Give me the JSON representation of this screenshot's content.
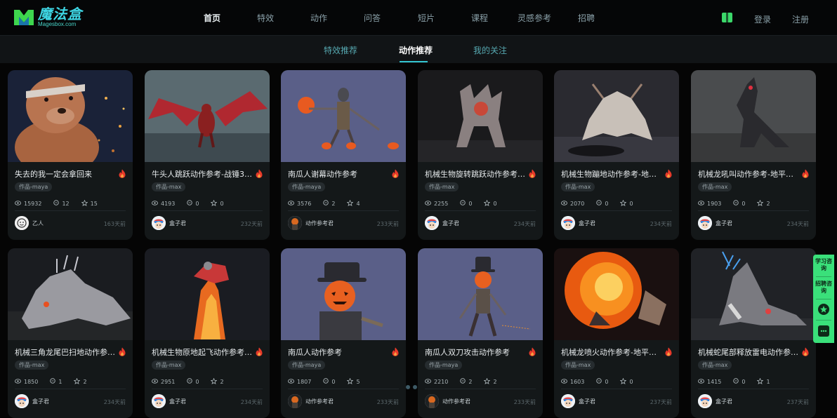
{
  "header": {
    "logo_cn": "魔法盒",
    "logo_en": "Magesbox.com",
    "nav": [
      "首页",
      "特效",
      "动作",
      "问答",
      "短片",
      "课程",
      "灵感参考",
      "招聘"
    ],
    "login": "登录",
    "register": "注册"
  },
  "subnav": {
    "tabs": [
      "特效推荐",
      "动作推荐",
      "我的关注"
    ]
  },
  "cards": [
    {
      "title": "失去的我一定会拿回来",
      "tag": "作品-maya",
      "views": "15932",
      "comments": "12",
      "stars": "15",
      "user": "乙人",
      "ago": "163天前",
      "thumb": "bear"
    },
    {
      "title": "牛头人跳跃动作参考-战锤3 Th...",
      "tag": "作品-max",
      "views": "4193",
      "comments": "0",
      "stars": "0",
      "user": "盒子君",
      "ago": "232天前",
      "thumb": "dragon"
    },
    {
      "title": "南瓜人谢幕动作参考",
      "tag": "作品-maya",
      "views": "3576",
      "comments": "2",
      "stars": "4",
      "user": "动作参考君",
      "ago": "233天前",
      "thumb": "pumpkin1"
    },
    {
      "title": "机械生物旋转跳跃动作参考-地...",
      "tag": "作品-max",
      "views": "2255",
      "comments": "0",
      "stars": "0",
      "user": "盒子君",
      "ago": "234天前",
      "thumb": "mech1"
    },
    {
      "title": "机械生物蹦地动作参考-地平线...",
      "tag": "作品-max",
      "views": "2070",
      "comments": "0",
      "stars": "0",
      "user": "盒子君",
      "ago": "234天前",
      "thumb": "mech2"
    },
    {
      "title": "机械龙吼叫动作参考-地平线西...",
      "tag": "作品-max",
      "views": "1903",
      "comments": "0",
      "stars": "2",
      "user": "盒子君",
      "ago": "234天前",
      "thumb": "mech3"
    },
    {
      "title": "机械三角龙尾巴扫地动作参考-...",
      "tag": "作品-max",
      "views": "1850",
      "comments": "1",
      "stars": "2",
      "user": "盒子君",
      "ago": "234天前",
      "thumb": "mech4"
    },
    {
      "title": "机械生物原地起飞动作参考-地...",
      "tag": "作品-max",
      "views": "2951",
      "comments": "0",
      "stars": "2",
      "user": "盒子君",
      "ago": "234天前",
      "thumb": "fire1"
    },
    {
      "title": "南瓜人动作参考",
      "tag": "作品-maya",
      "views": "1807",
      "comments": "0",
      "stars": "5",
      "user": "动作参考君",
      "ago": "233天前",
      "thumb": "pumpkin2"
    },
    {
      "title": "南瓜人双刀攻击动作参考",
      "tag": "作品-maya",
      "views": "2210",
      "comments": "2",
      "stars": "2",
      "user": "动作参考君",
      "ago": "233天前",
      "thumb": "pumpkin3"
    },
    {
      "title": "机械龙喷火动作参考-地平线西...",
      "tag": "作品-max",
      "views": "1603",
      "comments": "0",
      "stars": "0",
      "user": "盒子君",
      "ago": "237天前",
      "thumb": "fire2"
    },
    {
      "title": "机械蛇尾部释放雷电动作参考-...",
      "tag": "作品-max",
      "views": "1415",
      "comments": "0",
      "stars": "1",
      "user": "盒子君",
      "ago": "237天前",
      "thumb": "mech5"
    }
  ],
  "side_panel": {
    "study": "学习咨询",
    "recruit": "招聘咨询"
  },
  "colors": {
    "accent": "#34c6d2",
    "side": "#3ae07a",
    "card": "#141819"
  }
}
